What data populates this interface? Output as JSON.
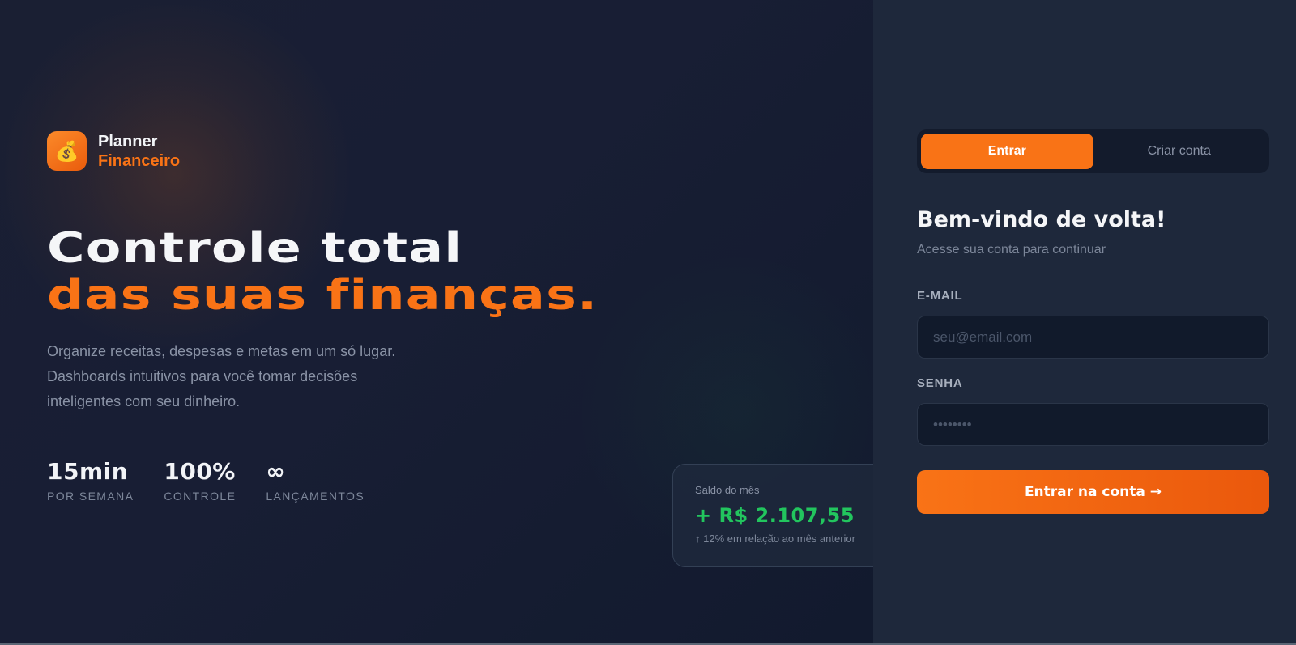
{
  "brand": {
    "logo_icon": "money-bag-icon",
    "logo_glyph": "💰",
    "line1": "Planner",
    "line2": "Financeiro"
  },
  "hero": {
    "line1": "Controle total",
    "line2": "das suas finanças.",
    "description": [
      "Organize receitas, despesas e metas em um só lugar.",
      "Dashboards intuitivos para você tomar decisões",
      "inteligentes com seu dinheiro."
    ]
  },
  "stats": [
    {
      "value": "15min",
      "label": "POR SEMANA"
    },
    {
      "value": "100%",
      "label": "CONTROLE"
    },
    {
      "value": "∞",
      "label": "LANÇAMENTOS"
    }
  ],
  "balance_card": {
    "label": "Saldo do mês",
    "value": "+ R$ 2.107,55",
    "trend": "↑ 12% em relação ao mês anterior"
  },
  "auth": {
    "tabs": [
      {
        "label": "Entrar",
        "active": true
      },
      {
        "label": "Criar conta",
        "active": false
      }
    ],
    "title": "Bem-vindo de volta!",
    "subtitle": "Acesse sua conta para continuar",
    "email": {
      "label": "E-MAIL",
      "placeholder": "seu@email.com",
      "value": ""
    },
    "password": {
      "label": "SENHA",
      "placeholder": "••••••••",
      "value": ""
    },
    "submit_label": "Entrar na conta →"
  },
  "colors": {
    "accent": "#f97316",
    "positive": "#22c55e",
    "background": "#141b2e",
    "panel": "#1e283b"
  }
}
